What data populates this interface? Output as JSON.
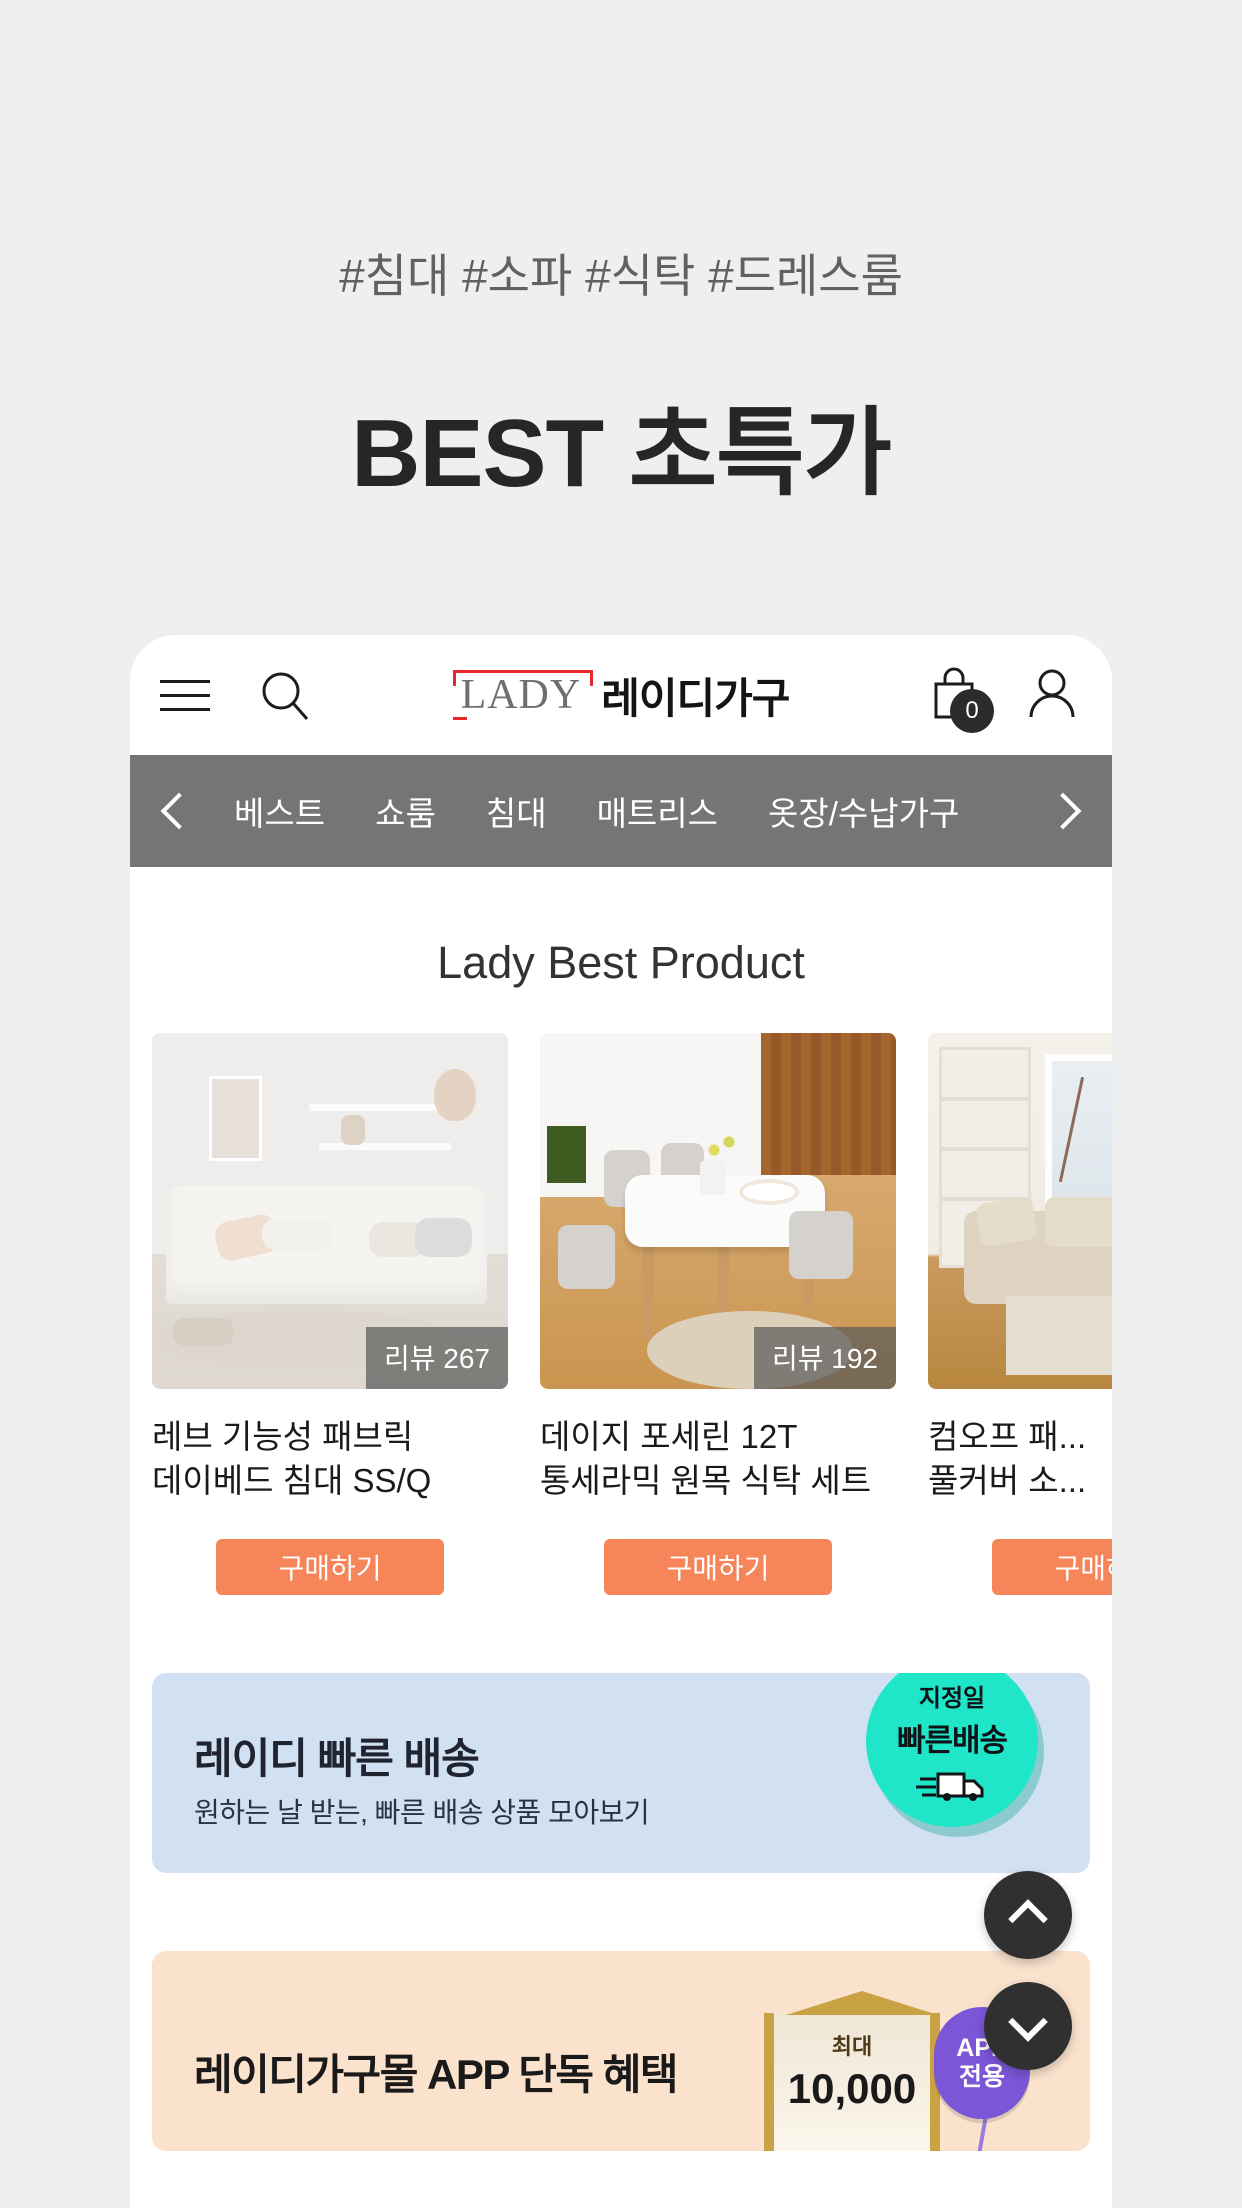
{
  "promo": {
    "tags": "#침대 #소파 #식탁 #드레스룸",
    "title": "BEST 초특가"
  },
  "app_header": {
    "menu_icon": "hamburger-icon",
    "search_icon": "search-icon",
    "brand_mark": "LADY",
    "brand_name": "레이디가구",
    "cart_icon": "shopping-bag-icon",
    "cart_count": "0",
    "account_icon": "user-icon"
  },
  "category_nav": {
    "prev_icon": "chevron-left-icon",
    "next_icon": "chevron-right-icon",
    "items": [
      {
        "label": "베스트"
      },
      {
        "label": "쇼룸"
      },
      {
        "label": "침대"
      },
      {
        "label": "매트리스"
      },
      {
        "label": "옷장/수납가구"
      }
    ]
  },
  "best_section": {
    "title": "Lady Best Product",
    "products": [
      {
        "title": "레브 기능성 패브릭\n데이베드 침대 SS/Q",
        "review_label": "리뷰 267",
        "buy_label": "구매하기"
      },
      {
        "title": "데이지 포세린 12T\n통세라믹 원목 식탁 세트",
        "review_label": "리뷰 192",
        "buy_label": "구매하기"
      },
      {
        "title": "컴오프 패...\n풀커버 소...",
        "review_label": "",
        "buy_label": "구매하기"
      }
    ]
  },
  "fast_delivery_banner": {
    "title": "레이디 빠른 배송",
    "subtitle": "원하는 날 받는, 빠른 배송 상품 모아보기",
    "badge_top": "지정일",
    "badge_main": "빠른배송",
    "badge_icon": "delivery-truck-icon"
  },
  "app_banner": {
    "title": "레이디가구몰 APP 단독 혜택",
    "coupon_max_label": "최대",
    "coupon_amount": "10,000",
    "pill_line1": "APP",
    "pill_line2": "전용"
  },
  "floating": {
    "scroll_top_icon": "chevron-up-icon",
    "scroll_down_icon": "chevron-down-icon"
  },
  "colors": {
    "page_bg": "#efefef",
    "accent_orange": "#f7855a",
    "nav_bar": "#757575",
    "fast_banner_bg": "#d2e1f2",
    "fast_badge": "#1fe6c8",
    "app_banner_bg": "#fae2cd",
    "app_pill": "#7b56d6",
    "brand_red": "#e8262b"
  }
}
